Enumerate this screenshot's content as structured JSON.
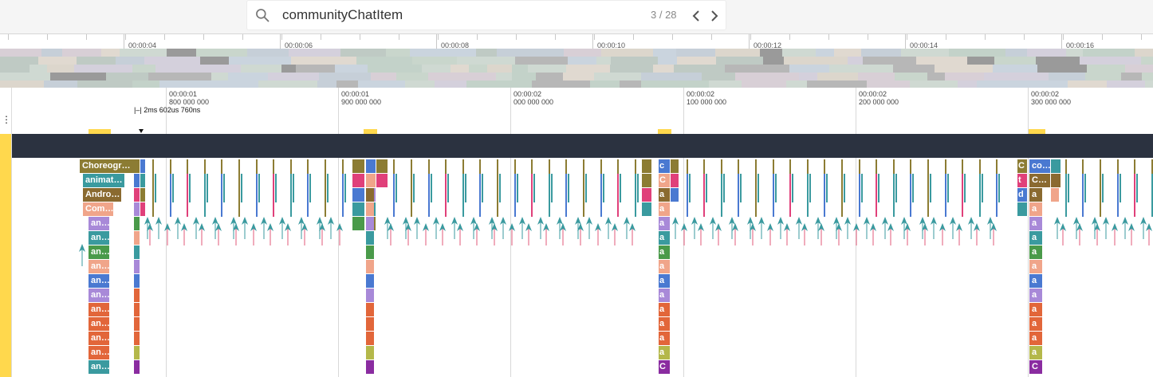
{
  "search": {
    "value": "communityChatItem",
    "counter": "3 / 28"
  },
  "overview": {
    "ticks": [
      "00:00:04",
      "00:00:06",
      "00:00:08",
      "00:00:10",
      "00:00:12",
      "00:00:14",
      "00:00:16"
    ]
  },
  "timeline": {
    "labels": [
      {
        "line1": "00:00:01",
        "line2": "800 000 000"
      },
      {
        "line1": "00:00:01",
        "line2": "900 000 000"
      },
      {
        "line1": "00:00:02",
        "line2": "000 000 000"
      },
      {
        "line1": "00:00:02",
        "line2": "100 000 000"
      },
      {
        "line1": "00:00:02",
        "line2": "200 000 000"
      },
      {
        "line1": "00:00:02",
        "line2": "300 000 000"
      }
    ],
    "cursor_label": "2ms 602us 760ns"
  },
  "slices": {
    "group1": [
      "Choreogr…",
      "animat…",
      "Andro…",
      "Com…",
      "an…",
      "an…",
      "an…",
      "an…",
      "an…",
      "an…",
      "an…",
      "an…",
      "an…",
      "an…",
      "an…"
    ],
    "group2_a": "C",
    "group2_b": "c",
    "group3_a": "C",
    "group3_col": [
      "c",
      "C",
      "a",
      "a",
      "a",
      "a",
      "a",
      "a",
      "a",
      "a",
      "a",
      "a",
      "a",
      "a",
      "C"
    ],
    "group4_a": [
      "C",
      "t",
      "d"
    ],
    "group4_col": [
      "co…",
      "C…",
      "a",
      "a",
      "a",
      "a",
      "a",
      "a",
      "a",
      "a",
      "a",
      "a",
      "a",
      "a",
      "C"
    ]
  },
  "colors": {
    "olive": "#8c7c33",
    "teal": "#3a9a9f",
    "brown": "#8a6a30",
    "purple": "#a889d8",
    "green": "#4a9a4a",
    "salmon": "#f0a58a",
    "blue": "#4a79d1",
    "orange": "#e2663a",
    "lime": "#b4b84a",
    "magenta": "#8a2ca0",
    "pink": "#e0407a"
  }
}
